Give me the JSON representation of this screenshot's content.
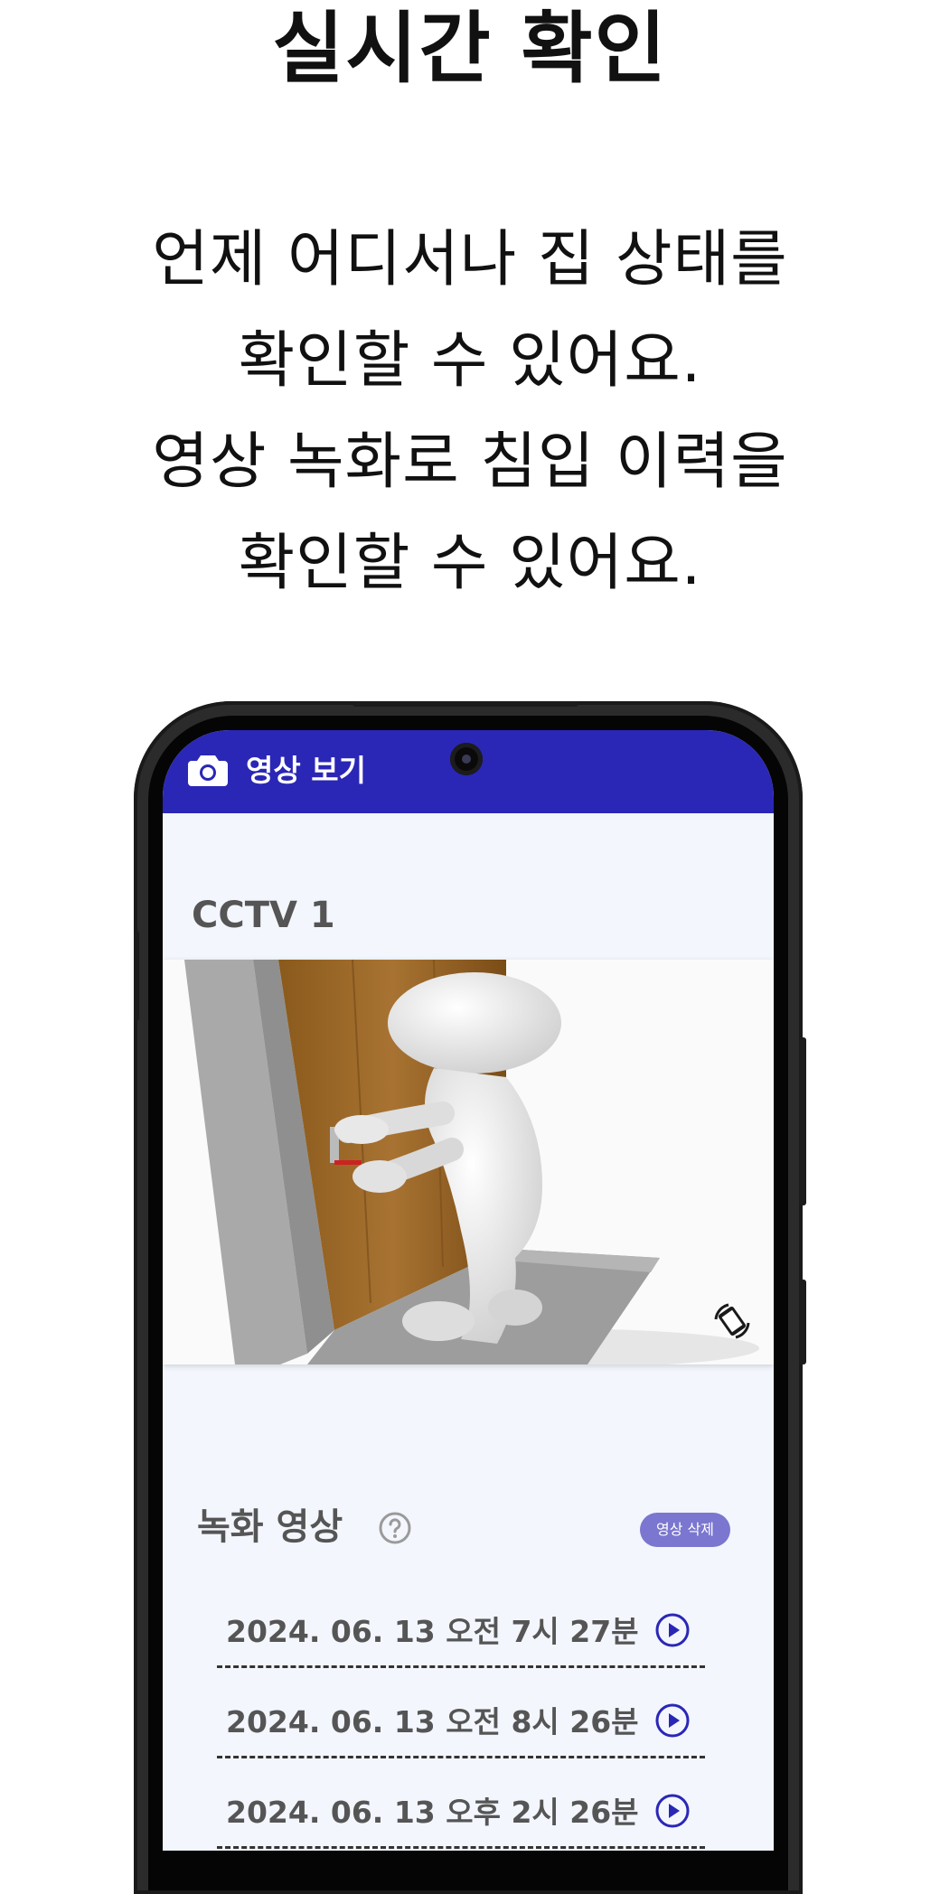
{
  "headline": "실시간 확인",
  "description": [
    "언제 어디서나 집 상태를",
    "확인할 수 있어요.",
    "영상 녹화로 침입 이력을",
    "확인할 수 있어요."
  ],
  "app": {
    "title": "영상 보기",
    "camera_icon": "camera-icon",
    "accent_color": "#2a27b6"
  },
  "cctv": {
    "name": "CCTV 1",
    "rotate_icon": "rotate-icon"
  },
  "recordings": {
    "title": "녹화 영상",
    "help_icon": "help-circle-icon",
    "delete_label": "영상 삭제",
    "items": [
      {
        "date": "2024. 06. 13 오전 7시 27분"
      },
      {
        "date": "2024. 06. 13 오전 8시 26분"
      },
      {
        "date": "2024. 06. 13 오후 2시 26분"
      }
    ]
  }
}
